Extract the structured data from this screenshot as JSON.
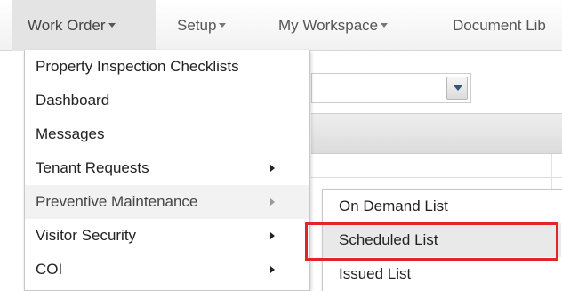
{
  "nav": {
    "items": [
      {
        "label": "Work Order",
        "has_caret": true
      },
      {
        "label": "Setup",
        "has_caret": true
      },
      {
        "label": "My Workspace",
        "has_caret": true
      },
      {
        "label": "Document Lib",
        "has_caret": false
      }
    ]
  },
  "dropdown": {
    "items": [
      {
        "label": "Property Inspection Checklists",
        "has_submenu": false
      },
      {
        "label": "Dashboard",
        "has_submenu": false
      },
      {
        "label": "Messages",
        "has_submenu": false
      },
      {
        "label": "Tenant Requests",
        "has_submenu": true
      },
      {
        "label": "Preventive Maintenance",
        "has_submenu": true
      },
      {
        "label": "Visitor Security",
        "has_submenu": true
      },
      {
        "label": "COI",
        "has_submenu": true
      }
    ]
  },
  "submenu": {
    "parent": "Preventive Maintenance",
    "items": [
      {
        "label": "On Demand List"
      },
      {
        "label": "Scheduled List",
        "highlighted": true
      },
      {
        "label": "Issued List"
      }
    ]
  },
  "colors": {
    "highlight_border": "#e0252b",
    "nav_active_bg": "#e4e4e4"
  },
  "icons": {
    "caret": "caret-down-icon",
    "submenu_arrow": "chevron-right-icon",
    "select_dropdown": "chevron-down-icon"
  }
}
